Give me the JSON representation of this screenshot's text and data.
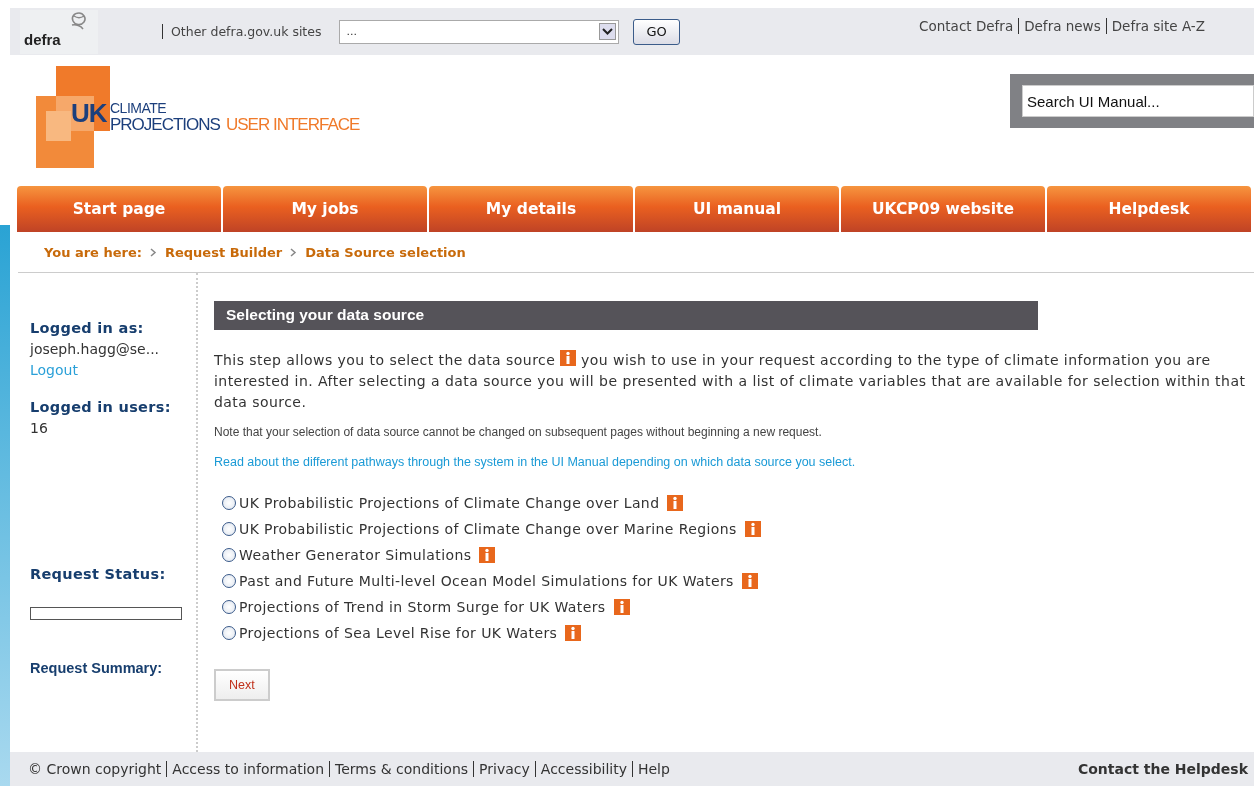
{
  "top_bar": {
    "brand": "defra",
    "sites_label": "Other defra.gov.uk sites",
    "sites_select": {
      "value": "..."
    },
    "go_button": "GO",
    "links": [
      "Contact Defra",
      "Defra news",
      "Defra site A-Z"
    ]
  },
  "header": {
    "logo": {
      "mark": "UK",
      "line1": "CLIMATE",
      "line2": "PROJECTIONS",
      "line3": "USER INTERFACE"
    },
    "search": {
      "value": "Search UI Manual..."
    }
  },
  "tabs": [
    {
      "label": "Start page",
      "selected": false
    },
    {
      "label": "My jobs",
      "selected": false
    },
    {
      "label": "My details",
      "selected": false
    },
    {
      "label": "UI manual",
      "selected": false
    },
    {
      "label": "UKCP09 website",
      "selected": false
    },
    {
      "label": "Helpdesk",
      "selected": false
    }
  ],
  "breadcrumb": {
    "label": "You are here:",
    "items": [
      "Request Builder",
      "Data Source selection"
    ]
  },
  "sidebar": {
    "logged_in_label": "Logged in as:",
    "user": "joseph.hagg@se...",
    "logout": "Logout",
    "users_label": "Logged in users:",
    "users_count": "16",
    "status_label": "Request Status:",
    "status_bar": {
      "level": 0
    },
    "summary_label": "Request Summary:"
  },
  "main": {
    "heading": "Selecting your data source",
    "intro_before": "This step allows you to select the data source",
    "intro_after": "you wish to use in your request according to the type of climate information you are interested in. After selecting a data source you will be presented with a list of climate variables that are available for selection within that data source.",
    "note": "Note that your selection of data source cannot be changed on subsequent pages without beginning a new request.",
    "link": "Read about the different pathways through the system in the UI Manual depending on which data source you select.",
    "options": [
      {
        "label": "UK Probabilistic Projections of Climate Change over Land",
        "selected": false
      },
      {
        "label": "UK Probabilistic Projections of Climate Change over Marine Regions",
        "selected": false
      },
      {
        "label": "Weather Generator Simulations",
        "selected": false
      },
      {
        "label": "Past and Future Multi-level Ocean Model Simulations for UK Waters",
        "selected": false
      },
      {
        "label": "Projections of Trend in Storm Surge for UK Waters",
        "selected": false
      },
      {
        "label": "Projections of Sea Level Rise for UK Waters",
        "selected": false
      }
    ],
    "next_button": "Next"
  },
  "footer": {
    "links": [
      "© Crown copyright",
      "Access to information",
      "Terms & conditions",
      "Privacy",
      "Accessibility",
      "Help"
    ],
    "helpdesk": "Contact the Helpdesk"
  }
}
